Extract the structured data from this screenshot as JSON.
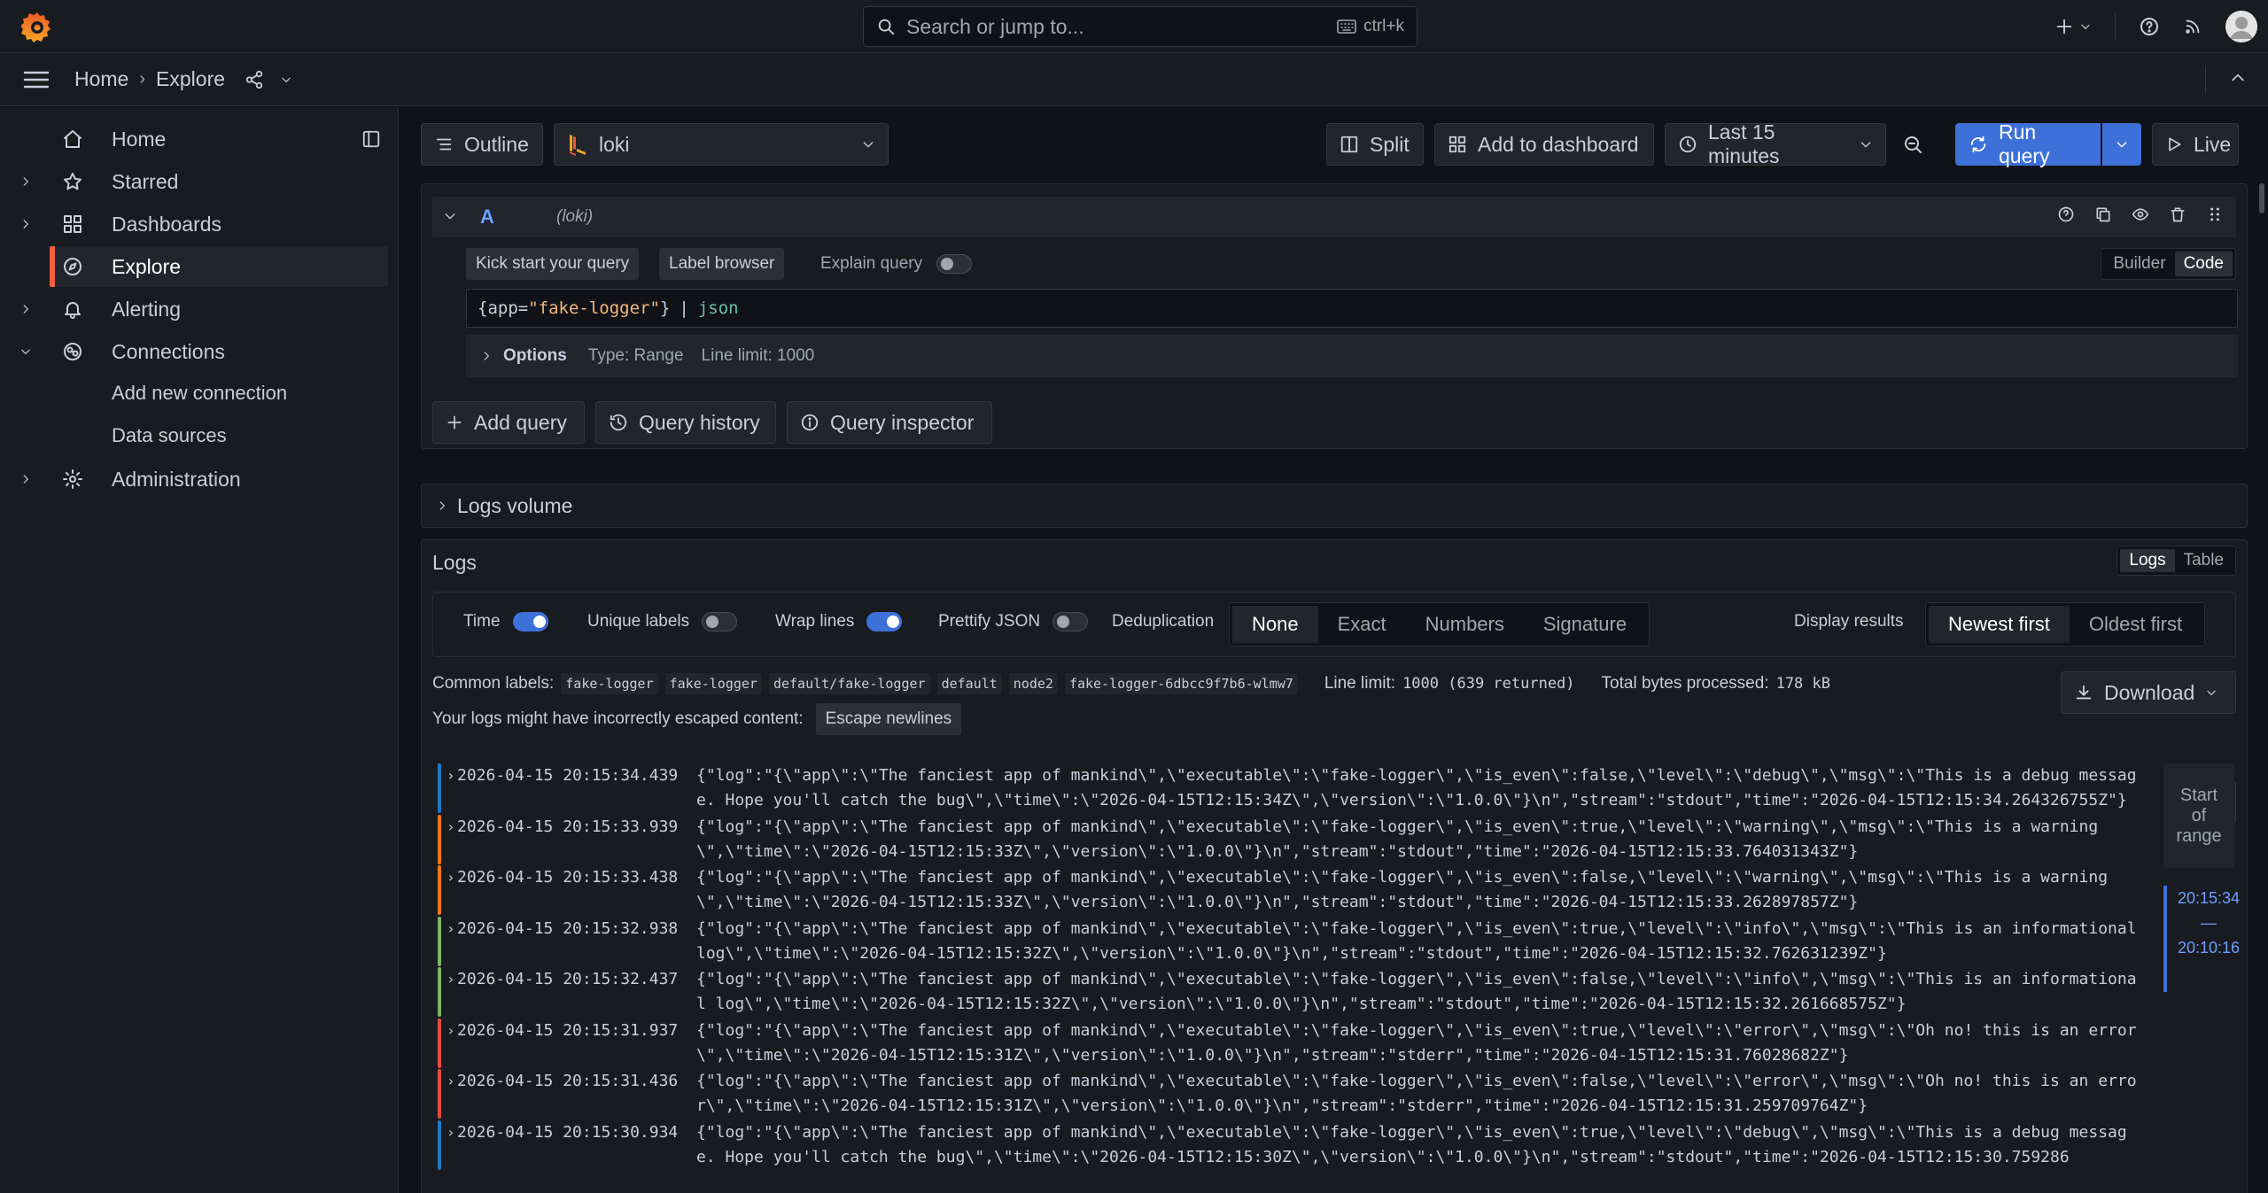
{
  "topbar": {
    "search_placeholder": "Search or jump to...",
    "search_shortcut": "ctrl+k",
    "icons": [
      "grafana-logo",
      "search-icon",
      "keyboard-icon",
      "plus-icon",
      "help-icon",
      "rss-icon",
      "avatar"
    ]
  },
  "breadcrumb": {
    "items": [
      "Home",
      "Explore"
    ]
  },
  "sidebar": {
    "items": [
      {
        "label": "Home",
        "icon": "home-icon"
      },
      {
        "label": "Starred",
        "icon": "star-icon"
      },
      {
        "label": "Dashboards",
        "icon": "apps-icon"
      },
      {
        "label": "Explore",
        "icon": "compass-icon"
      },
      {
        "label": "Alerting",
        "icon": "bell-icon"
      },
      {
        "label": "Connections",
        "icon": "connections-icon"
      },
      {
        "label": "Add new connection"
      },
      {
        "label": "Data sources"
      },
      {
        "label": "Administration",
        "icon": "cog-icon"
      }
    ]
  },
  "toolbar": {
    "outline": "Outline",
    "datasource": "loki",
    "split": "Split",
    "add_to_dashboard": "Add to dashboard",
    "time_range": "Last 15 minutes",
    "run_query": "Run query",
    "live": "Live"
  },
  "query": {
    "ref_id": "A",
    "datasource_label": "(loki)",
    "kick_start": "Kick start your query",
    "label_browser": "Label browser",
    "explain_query": "Explain query",
    "mode_builder": "Builder",
    "mode_code": "Code",
    "expr_open": "{",
    "expr_key": "app",
    "expr_eq": "=",
    "expr_val": "\"fake-logger\"",
    "expr_close": "}",
    "expr_pipe": "|",
    "expr_stage": "json",
    "options_label": "Options",
    "options_type": "Type: Range",
    "options_limit": "Line limit: 1000",
    "add_query": "Add query",
    "query_history": "Query history",
    "query_inspector": "Query inspector"
  },
  "logs_volume": {
    "label": "Logs volume"
  },
  "logs": {
    "title": "Logs",
    "view_logs": "Logs",
    "view_table": "Table",
    "controls": {
      "time": "Time",
      "time_on": true,
      "unique_labels": "Unique labels",
      "unique_labels_on": false,
      "wrap_lines": "Wrap lines",
      "wrap_lines_on": true,
      "prettify_json": "Prettify JSON",
      "prettify_json_on": false,
      "deduplication": "Deduplication",
      "dedup_options": [
        "None",
        "Exact",
        "Numbers",
        "Signature"
      ],
      "dedup_selected": "None",
      "display_results": "Display results",
      "order_options": [
        "Newest first",
        "Oldest first"
      ],
      "order_selected": "Newest first"
    },
    "common_labels_label": "Common labels:",
    "common_labels": [
      "fake-logger",
      "fake-logger",
      "default/fake-logger",
      "default",
      "node2",
      "fake-logger-6dbcc9f7b6-wlmw7"
    ],
    "line_limit_label": "Line limit:",
    "line_limit_value": "1000 (639 returned)",
    "total_bytes_label": "Total bytes processed:",
    "total_bytes_value": "178 kB",
    "download": "Download",
    "escape_warning": "Your logs might have incorrectly escaped content:",
    "escape_newlines": "Escape newlines",
    "start_of_range": "Start of range",
    "range_start": "20:15:34",
    "range_dash": "—",
    "range_end": "20:10:16",
    "level_colors": {
      "debug": "#1f78c1",
      "warning": "#eb7b18",
      "info": "#7eb26d",
      "error": "#e24d42"
    },
    "rows": [
      {
        "level": "debug",
        "time": "2026-04-15 20:15:34.439",
        "line": "{\"log\":\"{\\\"app\\\":\\\"The fanciest app of mankind\\\",\\\"executable\\\":\\\"fake-logger\\\",\\\"is_even\\\":false,\\\"level\\\":\\\"debug\\\",\\\"msg\\\":\\\"This is a debug message. Hope you'll catch the bug\\\",\\\"time\\\":\\\"2026-04-15T12:15:34Z\\\",\\\"version\\\":\\\"1.0.0\\\"}\\n\",\"stream\":\"stdout\",\"time\":\"2026-04-15T12:15:34.264326755Z\"}"
      },
      {
        "level": "warning",
        "time": "2026-04-15 20:15:33.939",
        "line": "{\"log\":\"{\\\"app\\\":\\\"The fanciest app of mankind\\\",\\\"executable\\\":\\\"fake-logger\\\",\\\"is_even\\\":true,\\\"level\\\":\\\"warning\\\",\\\"msg\\\":\\\"This is a warning\\\",\\\"time\\\":\\\"2026-04-15T12:15:33Z\\\",\\\"version\\\":\\\"1.0.0\\\"}\\n\",\"stream\":\"stdout\",\"time\":\"2026-04-15T12:15:33.764031343Z\"}"
      },
      {
        "level": "warning",
        "time": "2026-04-15 20:15:33.438",
        "line": "{\"log\":\"{\\\"app\\\":\\\"The fanciest app of mankind\\\",\\\"executable\\\":\\\"fake-logger\\\",\\\"is_even\\\":false,\\\"level\\\":\\\"warning\\\",\\\"msg\\\":\\\"This is a warning\\\",\\\"time\\\":\\\"2026-04-15T12:15:33Z\\\",\\\"version\\\":\\\"1.0.0\\\"}\\n\",\"stream\":\"stdout\",\"time\":\"2026-04-15T12:15:33.262897857Z\"}"
      },
      {
        "level": "info",
        "time": "2026-04-15 20:15:32.938",
        "line": "{\"log\":\"{\\\"app\\\":\\\"The fanciest app of mankind\\\",\\\"executable\\\":\\\"fake-logger\\\",\\\"is_even\\\":true,\\\"level\\\":\\\"info\\\",\\\"msg\\\":\\\"This is an informational log\\\",\\\"time\\\":\\\"2026-04-15T12:15:32Z\\\",\\\"version\\\":\\\"1.0.0\\\"}\\n\",\"stream\":\"stdout\",\"time\":\"2026-04-15T12:15:32.762631239Z\"}"
      },
      {
        "level": "info",
        "time": "2026-04-15 20:15:32.437",
        "line": "{\"log\":\"{\\\"app\\\":\\\"The fanciest app of mankind\\\",\\\"executable\\\":\\\"fake-logger\\\",\\\"is_even\\\":false,\\\"level\\\":\\\"info\\\",\\\"msg\\\":\\\"This is an informational log\\\",\\\"time\\\":\\\"2026-04-15T12:15:32Z\\\",\\\"version\\\":\\\"1.0.0\\\"}\\n\",\"stream\":\"stdout\",\"time\":\"2026-04-15T12:15:32.261668575Z\"}"
      },
      {
        "level": "error",
        "time": "2026-04-15 20:15:31.937",
        "line": "{\"log\":\"{\\\"app\\\":\\\"The fanciest app of mankind\\\",\\\"executable\\\":\\\"fake-logger\\\",\\\"is_even\\\":true,\\\"level\\\":\\\"error\\\",\\\"msg\\\":\\\"Oh no! this is an error\\\",\\\"time\\\":\\\"2026-04-15T12:15:31Z\\\",\\\"version\\\":\\\"1.0.0\\\"}\\n\",\"stream\":\"stderr\",\"time\":\"2026-04-15T12:15:31.76028682Z\"}"
      },
      {
        "level": "error",
        "time": "2026-04-15 20:15:31.436",
        "line": "{\"log\":\"{\\\"app\\\":\\\"The fanciest app of mankind\\\",\\\"executable\\\":\\\"fake-logger\\\",\\\"is_even\\\":false,\\\"level\\\":\\\"error\\\",\\\"msg\\\":\\\"Oh no! this is an error\\\",\\\"time\\\":\\\"2026-04-15T12:15:31Z\\\",\\\"version\\\":\\\"1.0.0\\\"}\\n\",\"stream\":\"stderr\",\"time\":\"2026-04-15T12:15:31.259709764Z\"}"
      },
      {
        "level": "debug",
        "time": "2026-04-15 20:15:30.934",
        "line": "{\"log\":\"{\\\"app\\\":\\\"The fanciest app of mankind\\\",\\\"executable\\\":\\\"fake-logger\\\",\\\"is_even\\\":true,\\\"level\\\":\\\"debug\\\",\\\"msg\\\":\\\"This is a debug message. Hope you'll catch the bug\\\",\\\"time\\\":\\\"2026-04-15T12:15:30Z\\\",\\\"version\\\":\\\"1.0.0\\\"}\\n\",\"stream\":\"stdout\",\"time\":\"2026-04-15T12:15:30.759286"
      }
    ]
  }
}
